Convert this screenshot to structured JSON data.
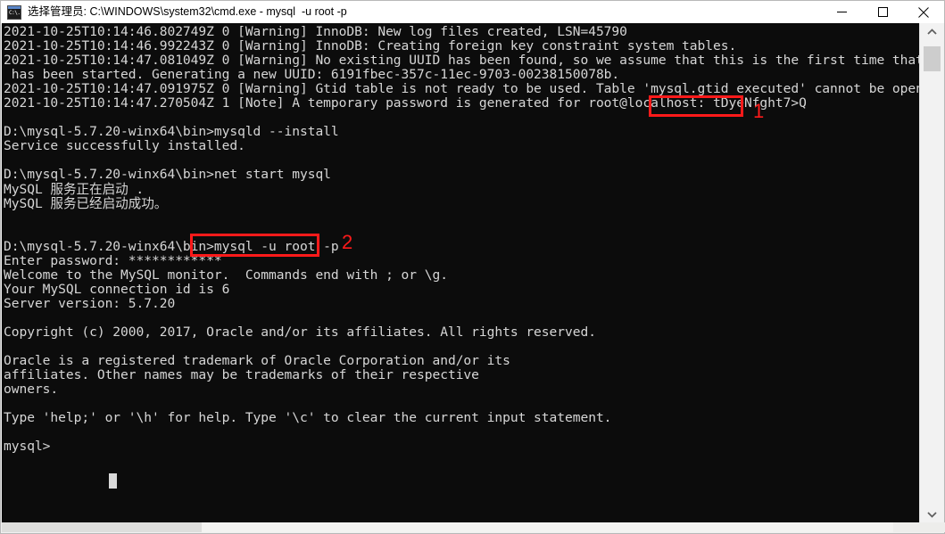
{
  "window": {
    "title": "选择管理员: C:\\WINDOWS\\system32\\cmd.exe - mysql  -u root -p",
    "icon_glyph": "C:\\.",
    "minimize_label": "Minimize",
    "maximize_label": "Maximize",
    "close_label": "Close"
  },
  "console": {
    "prompt_path": "D:\\mysql-5.7.20-winx64\\bin>",
    "cursor_visible": true,
    "lines": [
      "2021-10-25T10:14:46.802749Z 0 [Warning] InnoDB: New log files created, LSN=45790",
      "2021-10-25T10:14:46.992243Z 0 [Warning] InnoDB: Creating foreign key constraint system tables.",
      "2021-10-25T10:14:47.081049Z 0 [Warning] No existing UUID has been found, so we assume that this is the first time that this server",
      " has been started. Generating a new UUID: 6191fbec-357c-11ec-9703-00238150078b.",
      "2021-10-25T10:14:47.091975Z 0 [Warning] Gtid table is not ready to be used. Table 'mysql.gtid_executed' cannot be opened.",
      "2021-10-25T10:14:47.270504Z 1 [Note] A temporary password is generated for root@localhost: tDyeNfght7>Q",
      "",
      "D:\\mysql-5.7.20-winx64\\bin>mysqld --install",
      "Service successfully installed.",
      "",
      "D:\\mysql-5.7.20-winx64\\bin>net start mysql",
      "MySQL 服务正在启动 .",
      "MySQL 服务已经启动成功。",
      "",
      "",
      "D:\\mysql-5.7.20-winx64\\bin>mysql -u root -p",
      "Enter password: ************",
      "Welcome to the MySQL monitor.  Commands end with ; or \\g.",
      "Your MySQL connection id is 6",
      "Server version: 5.7.20",
      "",
      "Copyright (c) 2000, 2017, Oracle and/or its affiliates. All rights reserved.",
      "",
      "Oracle is a registered trademark of Oracle Corporation and/or its",
      "affiliates. Other names may be trademarks of their respective",
      "owners.",
      "",
      "Type 'help;' or '\\h' for help. Type '\\c' to clear the current input statement.",
      "",
      "mysql>"
    ]
  },
  "annotations": {
    "color": "#ff1a1a",
    "items": [
      {
        "number": "1",
        "target_text": "tDyeNfght7>Q",
        "meaning": "temporary-root-password"
      },
      {
        "number": "2",
        "target_text": "mysql -u root -p",
        "meaning": "login-command"
      }
    ]
  },
  "scrollbar": {
    "up_arrow": "˄",
    "down_arrow": "˅",
    "thumb_position": "near-top"
  }
}
